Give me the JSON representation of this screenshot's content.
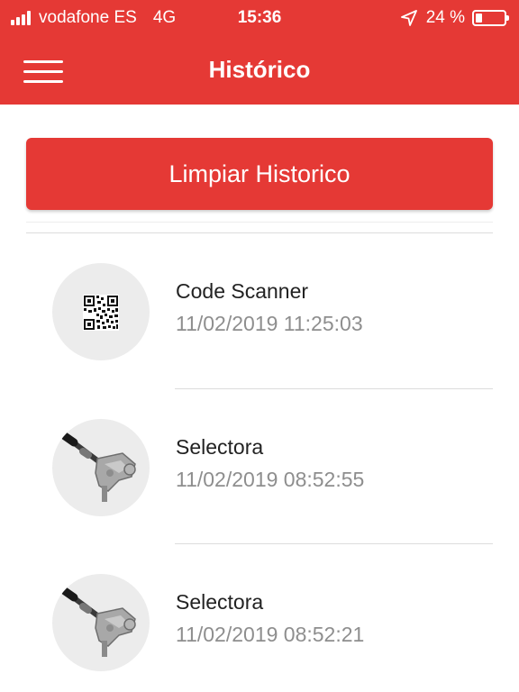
{
  "status_bar": {
    "carrier": "vodafone ES",
    "network": "4G",
    "time": "15:36",
    "battery_text": "24 %",
    "battery_level": 0.24
  },
  "header": {
    "title": "Histórico",
    "menu_icon": "hamburger-icon"
  },
  "actions": {
    "clear_label": "Limpiar Historico"
  },
  "history": {
    "items": [
      {
        "name": "Code Scanner",
        "date": "11/02/2019 11:25:03",
        "icon": "qr-code-icon"
      },
      {
        "name": "Selectora",
        "date": "11/02/2019 08:52:55",
        "icon": "selector-part-icon"
      },
      {
        "name": "Selectora",
        "date": "11/02/2019 08:52:21",
        "icon": "selector-part-icon"
      }
    ]
  },
  "colors": {
    "accent": "#e53935",
    "text_primary": "#222222",
    "text_secondary": "#8e8e8e",
    "thumb_background": "#ececec"
  }
}
